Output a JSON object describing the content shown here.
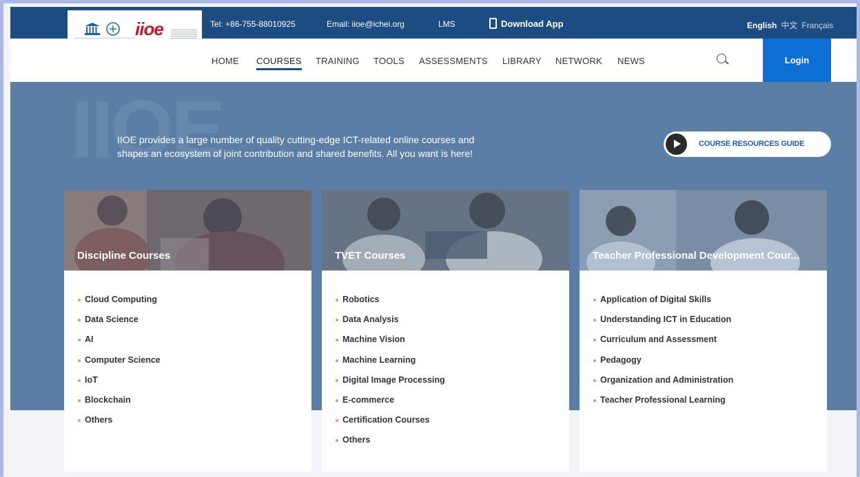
{
  "topbar": {
    "tel": "Tel: +86-755-88010925",
    "email": "Email: iioe@ichei.org",
    "lms": "LMS",
    "download": "Download App",
    "languages": {
      "english": "English",
      "chinese": "中文",
      "french": "Français"
    }
  },
  "logo": {
    "text": "iioe"
  },
  "nav": {
    "items": [
      "HOME",
      "COURSES",
      "TRAINING",
      "TOOLS",
      "ASSESSMENTS",
      "LIBRARY",
      "NETWORK",
      "NEWS"
    ],
    "active": "COURSES",
    "login": "Login"
  },
  "hero": {
    "watermark": "IIOE",
    "text_line1": "IIOE provides a large number of quality cutting-edge ICT-related online courses and",
    "text_line2": "shapes an ecosystem of joint contribution and shared benefits. All you want is here!",
    "guide_button": "COURSE RESOURCES GUIDE"
  },
  "cards": [
    {
      "title": "Discipline Courses",
      "items": [
        "Cloud Computing",
        "Data Science",
        "AI",
        "Computer Science",
        "IoT",
        "Blockchain",
        "Others"
      ]
    },
    {
      "title": "TVET Courses",
      "items": [
        "Robotics",
        "Data Analysis",
        "Machine Vision",
        "Machine Learning",
        "Digital Image Processing",
        "E-commerce",
        "Certification Courses",
        "Others"
      ]
    },
    {
      "title": "Teacher Professional Development Cour...",
      "items": [
        "Application of Digital Skills",
        "Understanding ICT in Education",
        "Curriculum and Assessment",
        "Pedagogy",
        "Organization and Administration",
        "Teacher Professional Learning"
      ]
    }
  ],
  "colors": {
    "topbar": "#1b4d83",
    "hero": "#5a7ea6",
    "login": "#0b6fd6",
    "bullet": "#e49a7a"
  }
}
